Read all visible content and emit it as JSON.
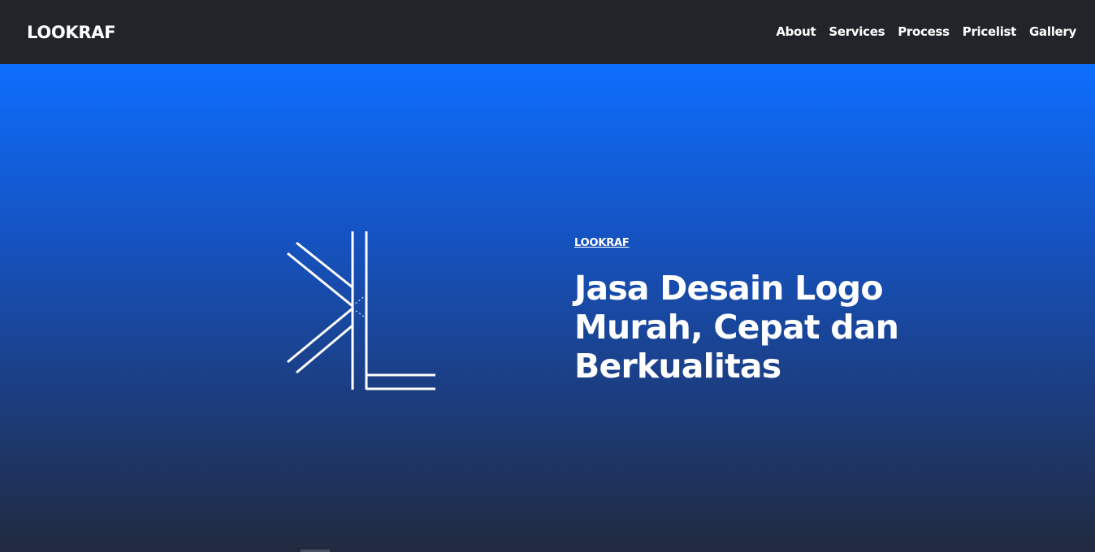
{
  "navbar": {
    "brand": "LOOKRAF",
    "links": [
      {
        "label": "About"
      },
      {
        "label": "Services"
      },
      {
        "label": "Process"
      },
      {
        "label": "Pricelist"
      },
      {
        "label": "Gallery"
      }
    ]
  },
  "hero": {
    "eyebrow": "LOOKRAF",
    "title": "Jasa Desain Logo Murah, Cepat dan Berkualitas",
    "logo_icon": "lookraf-kl-logo",
    "gradient_top": "#0d6efd",
    "gradient_bottom": "#212a3f"
  },
  "colors": {
    "navbar_bg": "#212529",
    "text": "#ffffff"
  }
}
